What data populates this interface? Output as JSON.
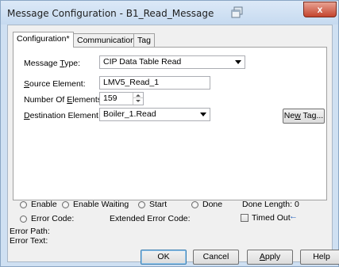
{
  "window": {
    "title": "Message Configuration - B1_Read_Message",
    "close_label": "x"
  },
  "tabs": [
    {
      "label": "Configuration*",
      "active": true
    },
    {
      "label": "Communication",
      "active": false
    },
    {
      "label": "Tag",
      "active": false
    }
  ],
  "config": {
    "message_type_label": {
      "pre": "Message ",
      "ul": "T",
      "post": "ype:"
    },
    "message_type_value": "CIP Data Table Read",
    "source_element_label": {
      "pre": "",
      "ul": "S",
      "post": "ource Element:"
    },
    "source_element_value": "LMV5_Read_1",
    "number_of_elements_label": {
      "pre": "Number Of ",
      "ul": "E",
      "post": "lements:"
    },
    "number_of_elements_value": "159",
    "destination_element_label": {
      "pre": "",
      "ul": "D",
      "post": "estination Element:"
    },
    "destination_element_value": "Boiler_1.Read",
    "new_tag_button": {
      "pre": "Ne",
      "ul": "w",
      "post": " Tag..."
    }
  },
  "status": {
    "enable": "Enable",
    "enable_waiting": "Enable Waiting",
    "start": "Start",
    "done": "Done",
    "done_length": "Done Length: 0",
    "error_code": "Error Code:",
    "extended_error_code": "Extended Error Code:",
    "timed_out": "Timed Out",
    "error_path": "Error Path:",
    "error_text": "Error Text:"
  },
  "buttons": {
    "ok": "OK",
    "cancel": "Cancel",
    "apply": {
      "pre": "",
      "ul": "A",
      "post": "pply"
    },
    "help": "Help"
  },
  "icons": {
    "restore": "window-restore-icon",
    "timed_out_arrow": "left-arrow-icon"
  },
  "colors": {
    "title_bar": "#c6daf0",
    "close_button": "#c4442e",
    "panel": "#ffffff",
    "default_button_border": "#3c7fb1",
    "arrow": "#1f5ebd"
  }
}
